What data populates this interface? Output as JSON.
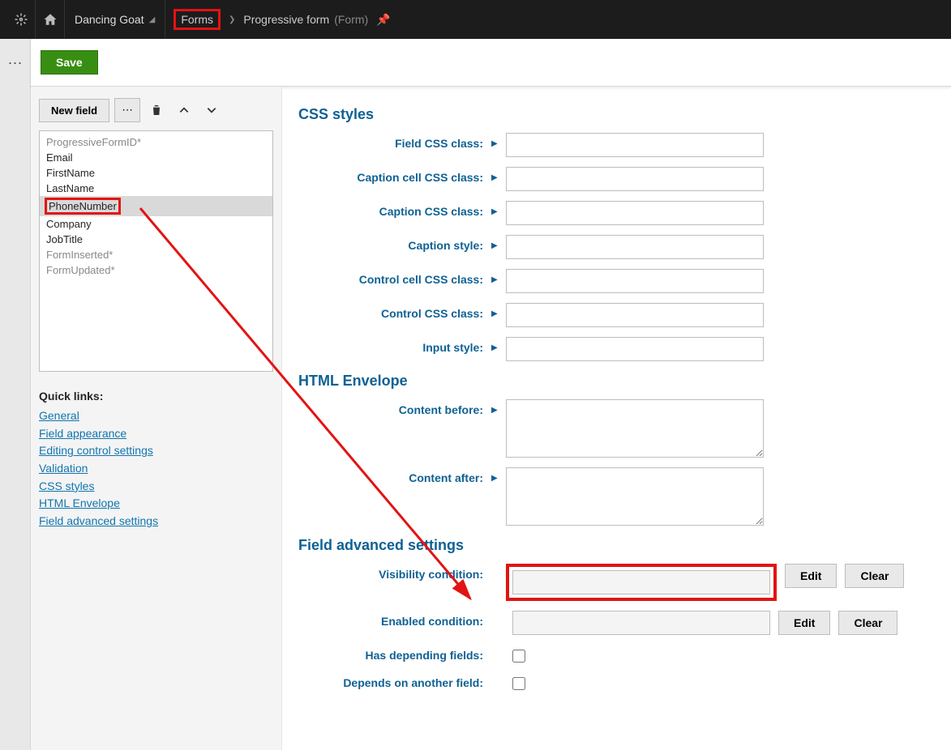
{
  "topbar": {
    "site": "Dancing Goat",
    "crumb_forms": "Forms",
    "crumb_page": "Progressive form",
    "crumb_type": "(Form)"
  },
  "savebar": {
    "save": "Save"
  },
  "sidebar": {
    "new_field": "New field",
    "fields": [
      {
        "label": "ProgressiveFormID*",
        "dim": true
      },
      {
        "label": "Email"
      },
      {
        "label": "FirstName"
      },
      {
        "label": "LastName"
      },
      {
        "label": "PhoneNumber",
        "sel": true,
        "highlight": true
      },
      {
        "label": "Company"
      },
      {
        "label": "JobTitle"
      },
      {
        "label": "FormInserted*",
        "dim": true
      },
      {
        "label": "FormUpdated*",
        "dim": true
      }
    ],
    "quick_title": "Quick links:",
    "quick_links": [
      "General",
      "Field appearance",
      "Editing control settings",
      "Validation",
      "CSS styles",
      "HTML Envelope",
      "Field advanced settings"
    ]
  },
  "sections": {
    "css": {
      "title": "CSS styles",
      "rows": {
        "field_css": "Field CSS class:",
        "caption_cell": "Caption cell CSS class:",
        "caption_css": "Caption CSS class:",
        "caption_style": "Caption style:",
        "control_cell": "Control cell CSS class:",
        "control_css": "Control CSS class:",
        "input_style": "Input style:"
      }
    },
    "html": {
      "title": "HTML Envelope",
      "before": "Content before:",
      "after": "Content after:"
    },
    "adv": {
      "title": "Field advanced settings",
      "visibility": "Visibility condition:",
      "enabled": "Enabled condition:",
      "has_dep": "Has depending fields:",
      "depends_on": "Depends on another field:",
      "edit": "Edit",
      "clear": "Clear"
    }
  }
}
